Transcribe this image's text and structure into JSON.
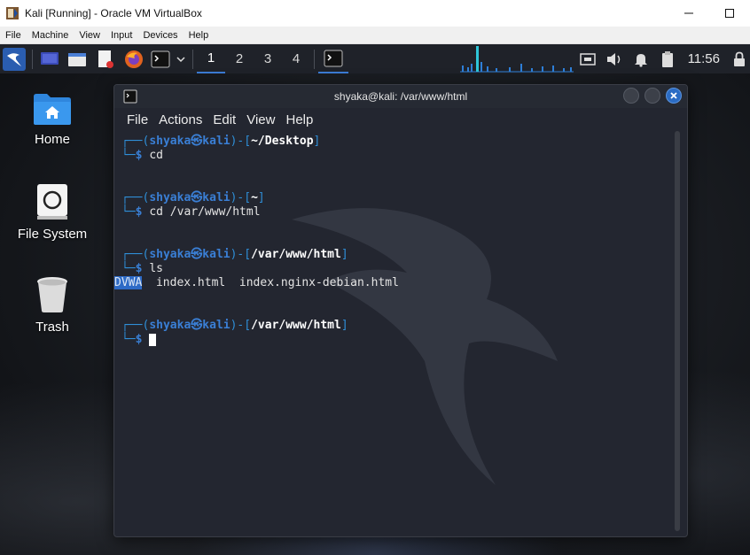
{
  "host": {
    "title": "Kali [Running] - Oracle VM VirtualBox",
    "controls": {
      "minimize": "—",
      "maximize": "☐"
    }
  },
  "vbox_menu": [
    "File",
    "Machine",
    "View",
    "Input",
    "Devices",
    "Help"
  ],
  "kali_panel": {
    "workspaces": [
      "1",
      "2",
      "3",
      "4"
    ],
    "active_workspace": "1",
    "clock": "11:56"
  },
  "desktop": {
    "icons": [
      {
        "label": "Home",
        "icon": "folder-home-icon"
      },
      {
        "label": "File System",
        "icon": "drive-icon"
      },
      {
        "label": "Trash",
        "icon": "trash-icon"
      }
    ]
  },
  "terminal": {
    "title": "shyaka@kali: /var/www/html",
    "menu": [
      "File",
      "Actions",
      "Edit",
      "View",
      "Help"
    ],
    "user": "shyaka",
    "at_symbol": "㉿",
    "host": "kali",
    "blocks": [
      {
        "path": "~/Desktop",
        "command": "cd"
      },
      {
        "path": "~",
        "command": "cd /var/www/html"
      },
      {
        "path": "/var/www/html",
        "command": "ls"
      }
    ],
    "ls_output": {
      "dir": "DVWA",
      "files": [
        "index.html",
        "index.nginx-debian.html"
      ]
    },
    "current_path": "/var/www/html"
  }
}
